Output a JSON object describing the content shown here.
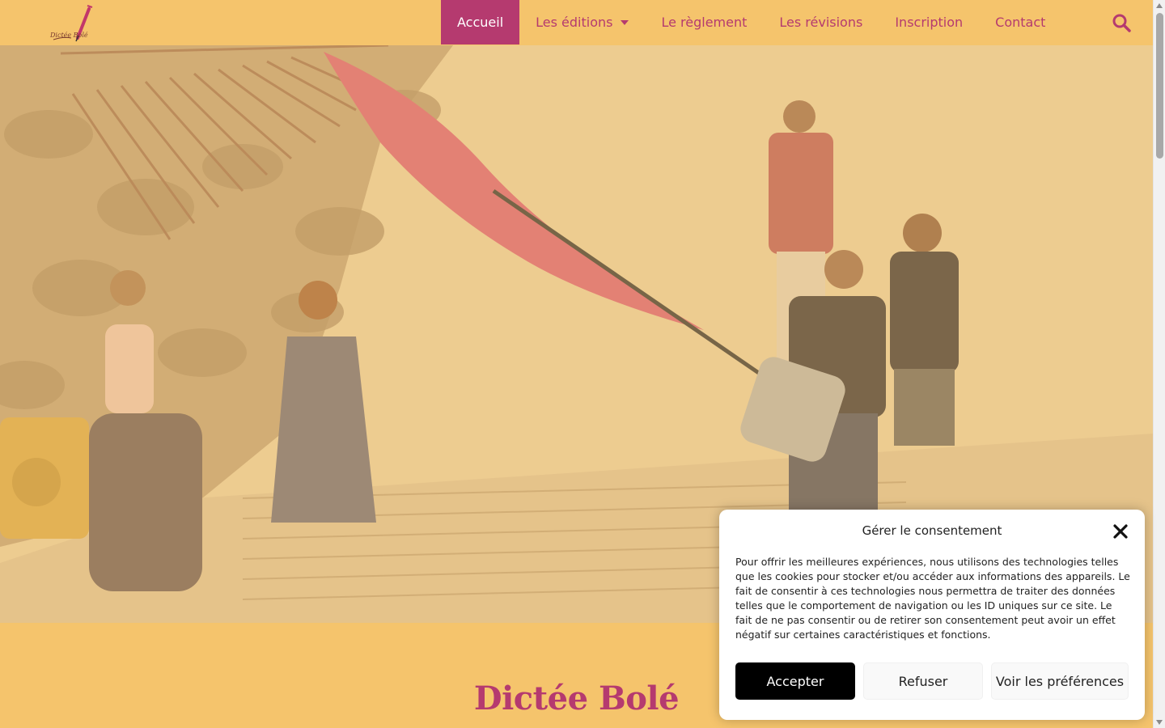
{
  "header": {
    "logo_text": "Dictée Bolé",
    "nav": [
      {
        "label": "Accueil",
        "active": true
      },
      {
        "label": "Les éditions",
        "has_dropdown": true
      },
      {
        "label": "Le règlement"
      },
      {
        "label": "Les révisions"
      },
      {
        "label": "Inscription"
      },
      {
        "label": "Contact"
      }
    ],
    "search_icon": "search-icon"
  },
  "content": {
    "title": "Dictée Bolé"
  },
  "consent": {
    "title": "Gérer le consentement",
    "text": "Pour offrir les meilleures expériences, nous utilisons des technologies telles que les cookies pour stocker et/ou accéder aux informations des appareils. Le fait de consentir à ces technologies nous permettra de traiter des données telles que le comportement de navigation ou les ID uniques sur ce site. Le fait de ne pas consentir ou de retirer son consentement peut avoir un effet négatif sur certaines caractéristiques et fonctions.",
    "accept_label": "Accepter",
    "refuse_label": "Refuser",
    "prefs_label": "Voir les préférences"
  },
  "colors": {
    "background": "#f5c46c",
    "accent": "#b53a6f",
    "accept_button": "#000000"
  }
}
